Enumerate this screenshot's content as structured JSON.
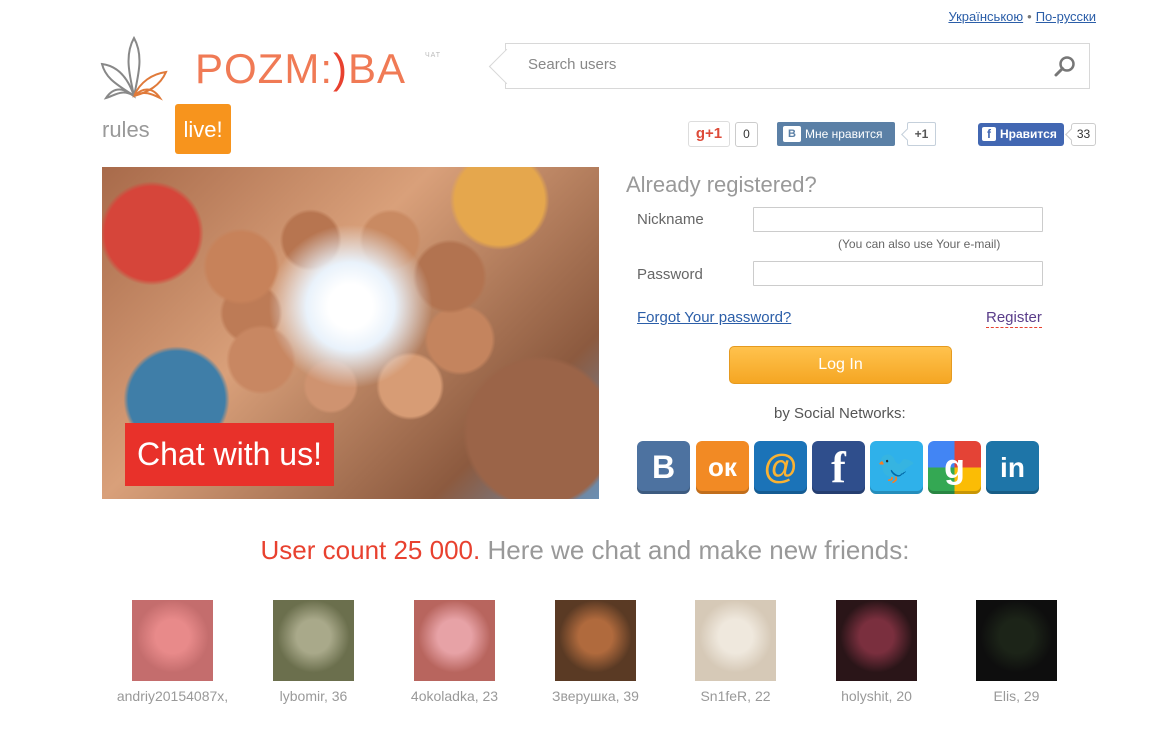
{
  "language": {
    "ukrainian": "Українською",
    "separator": "•",
    "russian": "По-русски"
  },
  "logo": {
    "text_left": "POZM:",
    "text_smile": ")",
    "text_right": "BA",
    "sub": "ЧАТ"
  },
  "search": {
    "placeholder": "Search users"
  },
  "nav": {
    "rules": "rules",
    "live": "live!"
  },
  "social_likes": {
    "gplus_label": "g+1",
    "gplus_count": "0",
    "vk_icon": "B",
    "vk_label": "Мне нравится",
    "vk_count": "+1",
    "fb_icon": "f",
    "fb_label": "Нравится",
    "fb_count": "33"
  },
  "hero": {
    "badge": "Chat with us!"
  },
  "login": {
    "heading": "Already registered?",
    "nickname_label": "Nickname",
    "nickname_value": "",
    "hint": "(You can also use Your e-mail)",
    "password_label": "Password",
    "password_value": "",
    "forgot": "Forgot Your password?",
    "register": "Register",
    "submit": "Log In",
    "by_social": "by Social Networks:"
  },
  "social_networks": [
    {
      "name": "vkontakte",
      "glyph": "B"
    },
    {
      "name": "odnoklassniki",
      "glyph": "ок"
    },
    {
      "name": "mail-ru",
      "glyph": "@"
    },
    {
      "name": "facebook",
      "glyph": "f"
    },
    {
      "name": "twitter",
      "glyph": "🐦"
    },
    {
      "name": "google",
      "glyph": "g"
    },
    {
      "name": "linkedin",
      "glyph": "in"
    }
  ],
  "user_count": {
    "red": "User count 25 000.",
    "rest": " Here we chat and make new friends:"
  },
  "users": [
    {
      "name": "andriy20154087x,",
      "colors": [
        "#c46d6d",
        "#e88a8a"
      ]
    },
    {
      "name": "lybomir, 36",
      "colors": [
        "#6b6f4d",
        "#a9a98a"
      ]
    },
    {
      "name": "4okoladka, 23",
      "colors": [
        "#b8655e",
        "#e7a2a6"
      ]
    },
    {
      "name": "Зверушка, 39",
      "colors": [
        "#5a3a24",
        "#b06a3d"
      ]
    },
    {
      "name": "Sn1feR, 22",
      "colors": [
        "#d6c9b7",
        "#efe8dd"
      ]
    },
    {
      "name": "holyshit, 20",
      "colors": [
        "#2a1518",
        "#7a2f3e"
      ]
    },
    {
      "name": "Elis, 29",
      "colors": [
        "#0e0e0e",
        "#1c2418"
      ]
    }
  ]
}
